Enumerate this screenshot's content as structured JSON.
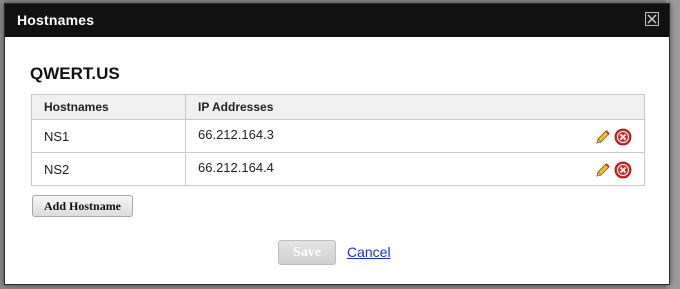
{
  "dialog": {
    "title": "Hostnames",
    "domain": "QWERT.US",
    "columns": {
      "hostnames": "Hostnames",
      "ip_addresses": "IP Addresses"
    },
    "rows": [
      {
        "hostname": "NS1",
        "ip": "66.212.164.3"
      },
      {
        "hostname": "NS2",
        "ip": "66.212.164.4"
      }
    ],
    "add_button": "Add Hostname",
    "save_button": "Save",
    "cancel_link": "Cancel"
  },
  "icons": {
    "close": "close-icon",
    "edit": "pencil-icon",
    "delete": "delete-circle-icon"
  },
  "colors": {
    "titlebar": "#111111",
    "delete_red": "#d12a2a",
    "link_blue": "#1a33cc"
  }
}
